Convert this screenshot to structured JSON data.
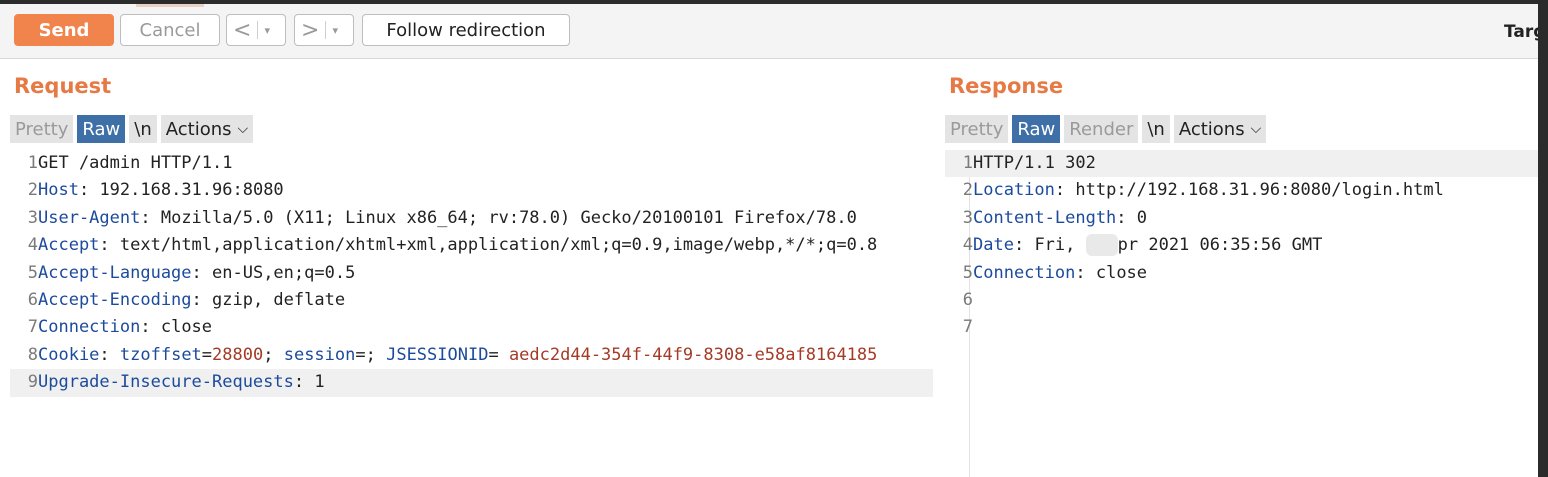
{
  "toolbar": {
    "send": "Send",
    "cancel": "Cancel",
    "back": "<",
    "forward": ">",
    "dropdown_caret": "▾",
    "follow_redirection": "Follow redirection",
    "target": "Targ"
  },
  "request": {
    "title": "Request",
    "tabs": {
      "pretty": "Pretty",
      "raw": "Raw",
      "newline": "\\n",
      "actions": "Actions"
    },
    "lines": {
      "l1": {
        "num": "1",
        "text": "GET /admin HTTP/1.1"
      },
      "l2": {
        "num": "2",
        "key": "Host",
        "value": " 192.168.31.96:8080"
      },
      "l3": {
        "num": "3",
        "key": "User-Agent",
        "value": " Mozilla/5.0 (X11; Linux x86_64; rv:78.0) Gecko/20100101 Firefox/78.0"
      },
      "l4": {
        "num": "4",
        "key": "Accept",
        "value": " text/html,application/xhtml+xml,application/xml;q=0.9,image/webp,*/*;q=0.8"
      },
      "l5": {
        "num": "5",
        "key": "Accept-Language",
        "value": " en-US,en;q=0.5"
      },
      "l6": {
        "num": "6",
        "key": "Accept-Encoding",
        "value": " gzip, deflate"
      },
      "l7": {
        "num": "7",
        "key": "Connection",
        "value": " close"
      },
      "l8": {
        "num": "8",
        "key": "Cookie",
        "c1_name": "tzoffset",
        "c1_value": "28800",
        "c2_name": "session",
        "c3_name": "JSESSIONID",
        "c3_value": "aedc2d44-354f-44f9-8308-e58af8164185"
      },
      "l9": {
        "num": "9",
        "key": "Upgrade-Insecure-Requests",
        "value": " 1"
      }
    }
  },
  "response": {
    "title": "Response",
    "tabs": {
      "pretty": "Pretty",
      "raw": "Raw",
      "render": "Render",
      "newline": "\\n",
      "actions": "Actions"
    },
    "lines": {
      "l1": {
        "num": "1",
        "text": "HTTP/1.1 302"
      },
      "l2": {
        "num": "2",
        "key": "Location",
        "value": " http://192.168.31.96:8080/login.html"
      },
      "l3": {
        "num": "3",
        "key": "Content-Length",
        "value": " 0"
      },
      "l4": {
        "num": "4",
        "key": "Date",
        "value_start": " Fri,",
        "value_end": "pr 2021 06:35:56 GMT"
      },
      "l5": {
        "num": "5",
        "key": "Connection",
        "value": " close"
      },
      "l6": {
        "num": "6"
      },
      "l7": {
        "num": "7"
      }
    }
  },
  "colors": {
    "accent": "#f0844c",
    "title": "#e67a45",
    "active_tab": "#3e6fa6",
    "header_key": "#1c4a9c",
    "cookie_value": "#a53a26"
  }
}
